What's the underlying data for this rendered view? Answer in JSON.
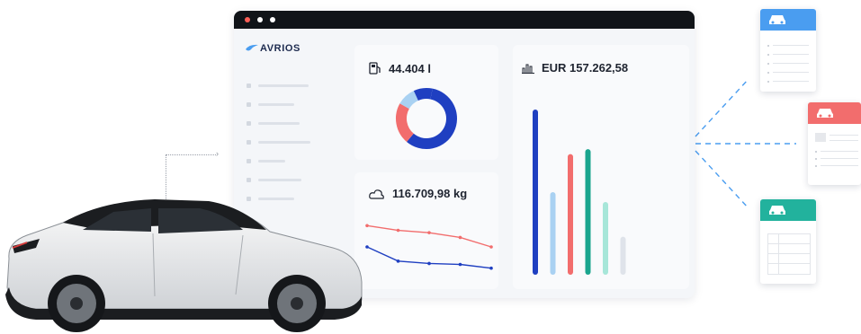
{
  "app": {
    "logo_text": "AVRIOS",
    "window_dots": [
      "#ff5f57",
      "#ffffff",
      "#ffffff"
    ],
    "nav_items": 7
  },
  "metrics": {
    "fuel": {
      "value": "44.404 l",
      "icon": "fuel-pump-icon"
    },
    "co2": {
      "value": "116.709,98 kg",
      "icon": "co2-cloud-icon"
    },
    "cost": {
      "value": "EUR 157.262,58",
      "icon": "bar-chart-icon"
    }
  },
  "chart_data": [
    {
      "type": "pie",
      "labels": [],
      "values": [
        58,
        22,
        10,
        10
      ],
      "colors": [
        "#1f3fc1",
        "#f26d6d",
        "#a9d1f2",
        "#1f3fc1"
      ]
    },
    {
      "type": "line",
      "x": [
        1,
        2,
        3,
        4,
        5
      ],
      "series": [
        {
          "values": [
            10,
            9,
            8.5,
            7.5,
            5.5
          ],
          "color": "#f26d6d"
        },
        {
          "values": [
            5.5,
            2.5,
            2,
            1.8,
            1
          ],
          "color": "#1f3fc1"
        }
      ]
    },
    {
      "type": "bar",
      "categories": [
        "1",
        "2",
        "3",
        "4",
        "5",
        "6"
      ],
      "values": [
        100,
        50,
        73,
        76,
        44,
        23
      ],
      "colors": [
        "#1f3fc1",
        "#a9d1f2",
        "#f26d6d",
        "#1aa58e",
        "#a7e6d9",
        "#dfe3ea"
      ],
      "ylim": [
        0,
        100
      ]
    }
  ],
  "documents": [
    {
      "color": "#4a9df0",
      "icon": "car-icon"
    },
    {
      "color": "#f26d6d",
      "icon": "car-icon"
    },
    {
      "color": "#22b29d",
      "icon": "car-icon"
    }
  ]
}
